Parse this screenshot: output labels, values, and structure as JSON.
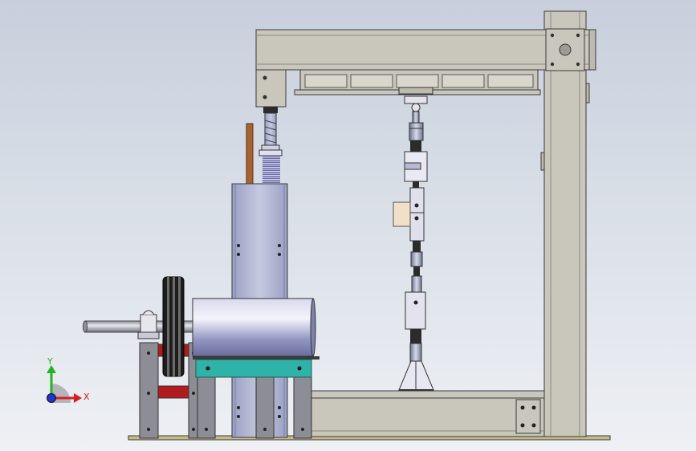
{
  "viewport": {
    "background_top": "#c8cfdc",
    "background_bottom": "#eef0f4"
  },
  "triad": {
    "x_label": "X",
    "y_label": "Y",
    "x_color": "#d62020",
    "y_color": "#22b422",
    "z_color": "#2233cc"
  },
  "colors": {
    "frame": "#c9c6bb",
    "frame_edge": "#3a3a3a",
    "spring": "#8f8fc8",
    "motor": "#aeb0d6",
    "teal_plate": "#2fb3a8",
    "red_block": "#b21b1b",
    "copper_rod": "#a7632f",
    "load_block": "#f1dfc8"
  }
}
